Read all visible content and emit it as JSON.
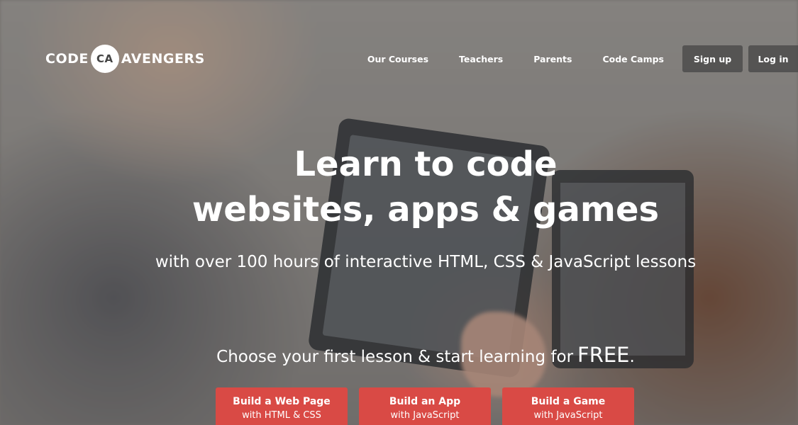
{
  "header": {
    "logo_left": "CODE",
    "logo_badge": "CA",
    "logo_right": "AVENGERS",
    "nav": [
      {
        "label": "Our Courses"
      },
      {
        "label": "Teachers"
      },
      {
        "label": "Parents"
      },
      {
        "label": "Code Camps"
      }
    ],
    "signup_label": "Sign up",
    "login_label": "Log in"
  },
  "hero": {
    "headline_line1": "Learn to code",
    "headline_line2": "websites, apps & games",
    "subheadline": "with over 100 hours of interactive HTML, CSS & JavaScript lessons",
    "cta_text": "Choose your first lesson & start learning for",
    "cta_free": "FREE",
    "cta_period": "."
  },
  "cta_buttons": [
    {
      "title": "Build a Web Page",
      "subtitle": "with HTML & CSS"
    },
    {
      "title": "Build an App",
      "subtitle": "with JavaScript"
    },
    {
      "title": "Build a Game",
      "subtitle": "with JavaScript"
    }
  ],
  "colors": {
    "cta_red": "#d94a45",
    "nav_button_bg": "#464646",
    "text": "#ffffff"
  }
}
